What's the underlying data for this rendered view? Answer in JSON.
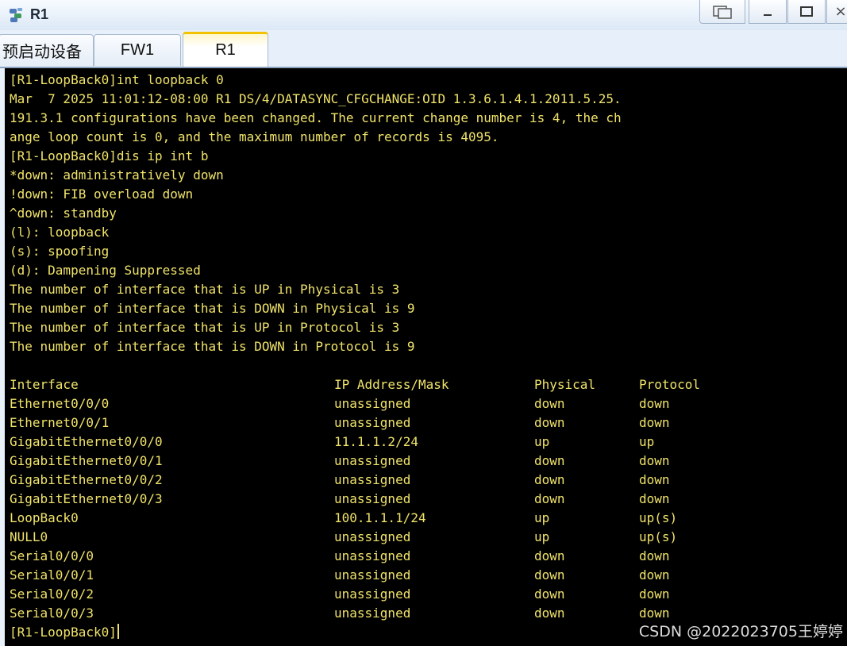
{
  "window": {
    "title": "R1",
    "controls": {
      "restore_icon": "restore-icon",
      "minimize_icon": "minimize-icon",
      "maximize_icon": "maximize-icon",
      "close_icon": "close-icon"
    }
  },
  "tabs": [
    {
      "label": "预启动设备"
    },
    {
      "label": "FW1"
    },
    {
      "label": "R1",
      "active": true
    }
  ],
  "terminal": {
    "lines_before": [
      "[R1-LoopBack0]int loopback 0",
      "Mar  7 2025 11:01:12-08:00 R1 DS/4/DATASYNC_CFGCHANGE:OID 1.3.6.1.4.1.2011.5.25.",
      "191.3.1 configurations have been changed. The current change number is 4, the ch",
      "ange loop count is 0, and the maximum number of records is 4095.",
      "[R1-LoopBack0]dis ip int b",
      "*down: administratively down",
      "!down: FIB overload down",
      "^down: standby",
      "(l): loopback",
      "(s): spoofing",
      "(d): Dampening Suppressed",
      "The number of interface that is UP in Physical is 3",
      "The number of interface that is DOWN in Physical is 9",
      "The number of interface that is UP in Protocol is 3",
      "The number of interface that is DOWN in Protocol is 9",
      ""
    ],
    "table": {
      "headers": [
        "Interface",
        "IP Address/Mask",
        "Physical",
        "Protocol"
      ],
      "rows": [
        [
          "Ethernet0/0/0",
          "unassigned",
          "down",
          "down"
        ],
        [
          "Ethernet0/0/1",
          "unassigned",
          "down",
          "down"
        ],
        [
          "GigabitEthernet0/0/0",
          "11.1.1.2/24",
          "up",
          "up"
        ],
        [
          "GigabitEthernet0/0/1",
          "unassigned",
          "down",
          "down"
        ],
        [
          "GigabitEthernet0/0/2",
          "unassigned",
          "down",
          "down"
        ],
        [
          "GigabitEthernet0/0/3",
          "unassigned",
          "down",
          "down"
        ],
        [
          "LoopBack0",
          "100.1.1.1/24",
          "up",
          "up(s)"
        ],
        [
          "NULL0",
          "unassigned",
          "up",
          "up(s)"
        ],
        [
          "Serial0/0/0",
          "unassigned",
          "down",
          "down"
        ],
        [
          "Serial0/0/1",
          "unassigned",
          "down",
          "down"
        ],
        [
          "Serial0/0/2",
          "unassigned",
          "down",
          "down"
        ],
        [
          "Serial0/0/3",
          "unassigned",
          "down",
          "down"
        ]
      ]
    },
    "prompt": "[R1-LoopBack0]",
    "text_color": "#f0e36a",
    "background_color": "#000000"
  },
  "watermark": "CSDN @2022023705王婷婷"
}
